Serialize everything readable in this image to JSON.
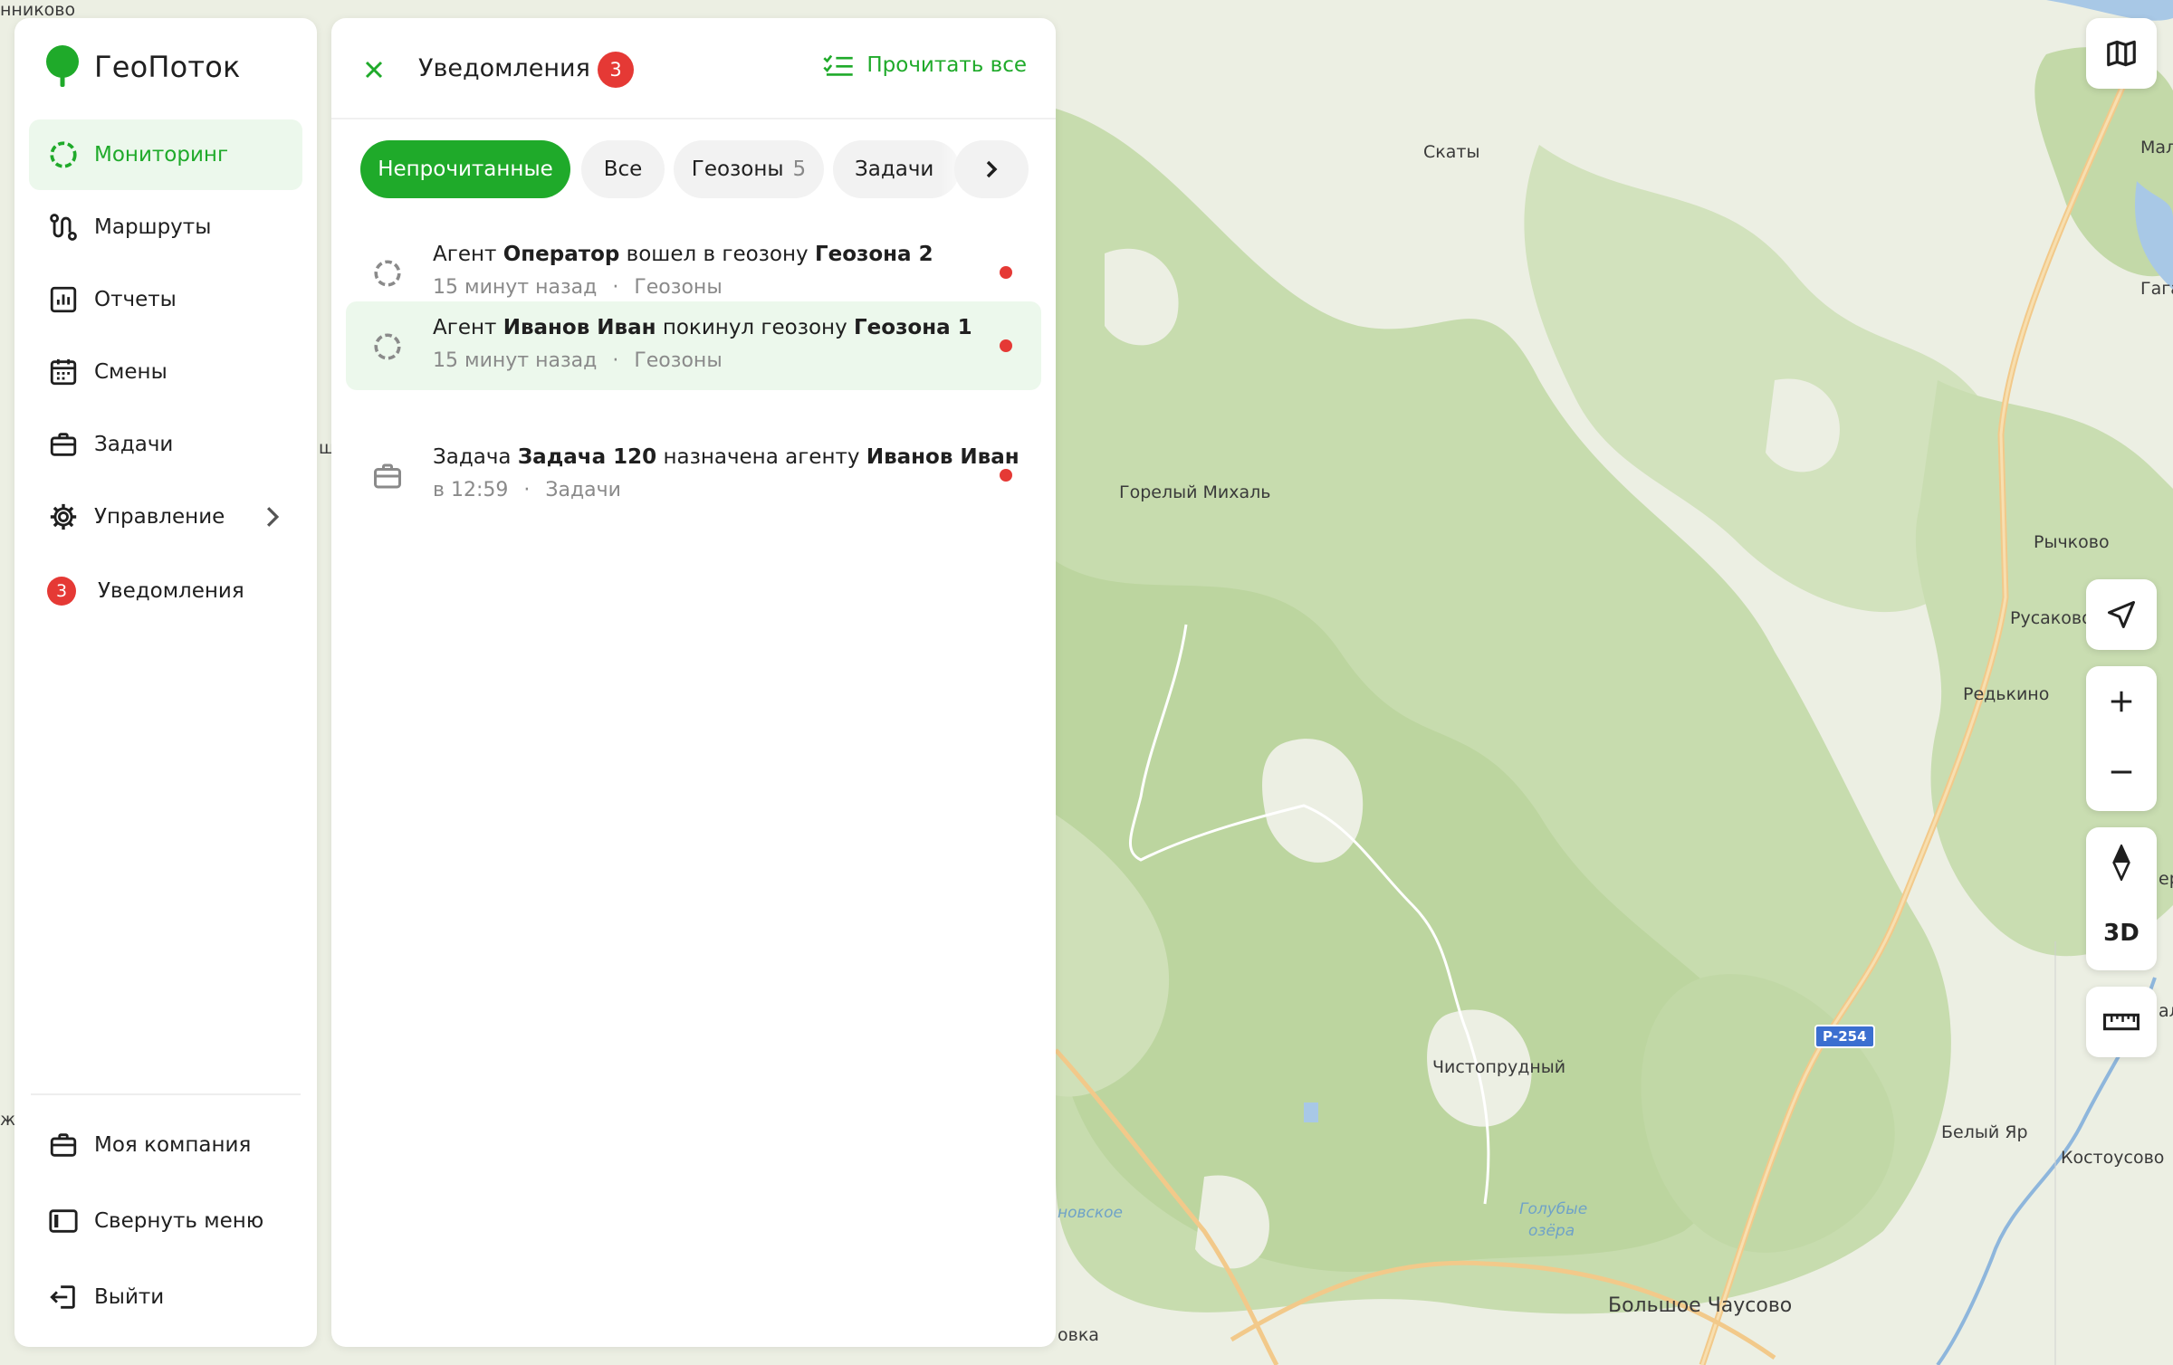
{
  "app": {
    "name": "ГеоПоток",
    "brand_color": "#1faa2a"
  },
  "sidebar": {
    "items": [
      {
        "key": "monitoring",
        "label": "Мониторинг",
        "icon": "monitoring-ring-icon",
        "active": true
      },
      {
        "key": "routes",
        "label": "Маршруты",
        "icon": "route-icon"
      },
      {
        "key": "reports",
        "label": "Отчеты",
        "icon": "chart-icon"
      },
      {
        "key": "shifts",
        "label": "Смены",
        "icon": "calendar-icon"
      },
      {
        "key": "tasks",
        "label": "Задачи",
        "icon": "briefcase-icon"
      },
      {
        "key": "management",
        "label": "Управление",
        "icon": "gear-icon",
        "has_submenu": true
      },
      {
        "key": "notifications",
        "label": "Уведомления",
        "badge": "3"
      }
    ],
    "bottom": [
      {
        "key": "company",
        "label": "Моя компания",
        "icon": "briefcase-icon"
      },
      {
        "key": "collapse",
        "label": "Свернуть меню",
        "icon": "collapse-icon"
      },
      {
        "key": "logout",
        "label": "Выйти",
        "icon": "logout-icon"
      }
    ]
  },
  "notifications_panel": {
    "title": "Уведомления",
    "count": "3",
    "read_all_label": "Прочитать все",
    "filters": [
      {
        "label": "Непрочитанные",
        "active": true
      },
      {
        "label": "Все"
      },
      {
        "label": "Геозоны",
        "count": "5"
      },
      {
        "label": "Задачи"
      }
    ],
    "items": [
      {
        "icon": "geozone-ring-icon",
        "parts": [
          "Агент ",
          "Оператор",
          " вошел в геозону ",
          "Геозона 2"
        ],
        "time": "15 минут назад",
        "sep": "·",
        "category": "Геозоны",
        "unread": true
      },
      {
        "icon": "geozone-ring-icon",
        "parts": [
          "Агент ",
          "Иванов Иван",
          " покинул геозону ",
          "Геозона 1"
        ],
        "time": "15 минут назад",
        "sep": "·",
        "category": "Геозоны",
        "unread": true,
        "hovered": true
      },
      {
        "icon": "briefcase-icon",
        "parts": [
          "Задача ",
          "Задача 120",
          " назначена агенту ",
          "Иванов Иван"
        ],
        "time": "в 12:59",
        "sep": "·",
        "category": "Задачи",
        "unread": true
      }
    ]
  },
  "map": {
    "labels": {
      "nikovo": "нниково",
      "skaty": "Скаты",
      "mal": "Мал",
      "gaga": "Гага",
      "gorely": "Горелый Михаль",
      "rychkovo": "Рычково",
      "rusakovo": "Русаково",
      "redkino": "Редькино",
      "er": "ер",
      "al": "ал",
      "chistoprudny": "Чистопрудный",
      "bely_yar": "Белый Яр",
      "kostousovo": "Костоусово",
      "golubye": "Голубые",
      "ozera": "озёра",
      "novskoe": "новское",
      "bolshoe": "Большое Чаусово",
      "ovka": "овка",
      "sh": "ш",
      "zh": "ж"
    },
    "road_badge": "Р-254",
    "controls": {
      "three_d_label": "3D"
    }
  }
}
